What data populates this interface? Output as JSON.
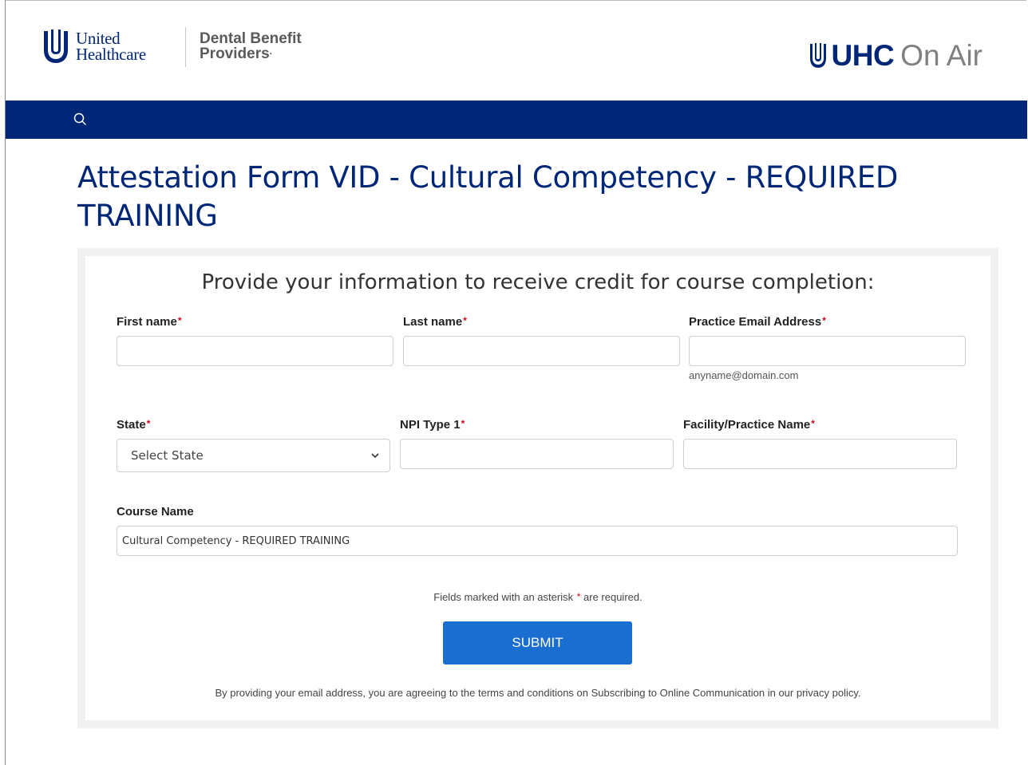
{
  "header": {
    "uh_logo_line1": "United",
    "uh_logo_line2": "Healthcare",
    "dbp_line1": "Dental Benefit",
    "dbp_line2": "Providers",
    "dbp_mark": "·",
    "onair_brand": "UHC",
    "onair_suffix": "On Air"
  },
  "nav": {
    "search_icon": "search-icon"
  },
  "page": {
    "title": "Attestation Form VID - Cultural Competency - REQUIRED TRAINING"
  },
  "form": {
    "heading": "Provide your information to receive credit for course completion:",
    "required_marker": "*",
    "first_name": {
      "label": "First name",
      "value": "",
      "placeholder": ""
    },
    "last_name": {
      "label": "Last name",
      "value": "",
      "placeholder": ""
    },
    "email": {
      "label": "Practice Email Address",
      "value": "",
      "hint": "anyname@domain.com"
    },
    "state": {
      "label": "State",
      "selected": "Select State"
    },
    "npi": {
      "label": "NPI Type 1",
      "value": ""
    },
    "facility": {
      "label": "Facility/Practice Name",
      "value": ""
    },
    "course": {
      "label": "Course Name",
      "value": "Cultural Competency - REQUIRED TRAINING"
    },
    "required_note_before": "Fields marked with an asterisk",
    "required_note_after": "are required.",
    "submit_label": "SUBMIT",
    "privacy_text": "By providing your email address, you are agreeing to the terms and conditions on Subscribing to Online Communication in our privacy policy."
  },
  "colors": {
    "brand_navy": "#002677",
    "submit_blue": "#196ecf",
    "required_red": "#d0021b"
  }
}
